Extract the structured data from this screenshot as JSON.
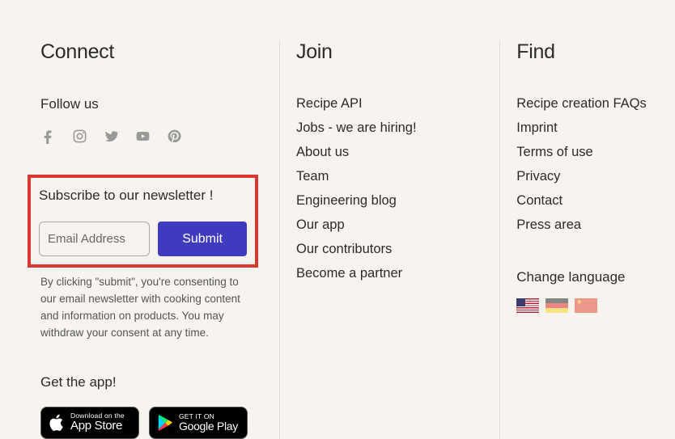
{
  "connect": {
    "heading": "Connect",
    "follow_label": "Follow us",
    "newsletter_heading": "Subscribe to our newsletter !",
    "email_placeholder": "Email Address",
    "submit_label": "Submit",
    "consent_text": "By clicking \"submit\", you're consenting to our email newsletter with cooking content and information on products. You may withdraw your consent at any time.",
    "get_app_label": "Get the app!",
    "appstore_top": "Download on the",
    "appstore_bottom": "App Store",
    "gplay_top": "GET IT ON",
    "gplay_bottom": "Google Play"
  },
  "join": {
    "heading": "Join",
    "items": [
      {
        "label": "Recipe API"
      },
      {
        "label": "Jobs - we are hiring!"
      },
      {
        "label": "About us"
      },
      {
        "label": "Team"
      },
      {
        "label": "Engineering blog"
      },
      {
        "label": "Our app"
      },
      {
        "label": "Our contributors"
      },
      {
        "label": "Become a partner"
      }
    ]
  },
  "find": {
    "heading": "Find",
    "items": [
      {
        "label": "Recipe creation FAQs"
      },
      {
        "label": "Imprint"
      },
      {
        "label": "Terms of use"
      },
      {
        "label": "Privacy"
      },
      {
        "label": "Contact"
      },
      {
        "label": "Press area"
      }
    ],
    "lang_heading": "Change language"
  }
}
